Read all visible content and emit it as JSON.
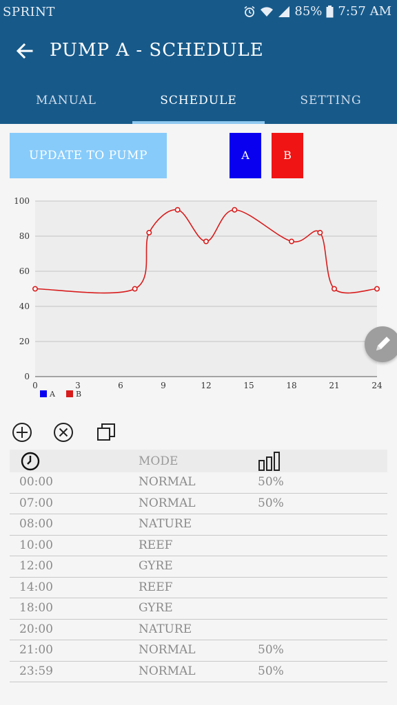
{
  "status_bar": {
    "carrier": "SPRINT",
    "battery": "85%",
    "time": "7:57 AM"
  },
  "app_bar": {
    "title": "PUMP A - SCHEDULE"
  },
  "tabs": [
    {
      "label": "MANUAL"
    },
    {
      "label": "SCHEDULE",
      "active": true
    },
    {
      "label": "SETTING"
    }
  ],
  "actions": {
    "update_label": "UPDATE TO PUMP",
    "pump_a_label": "A",
    "pump_b_label": "B"
  },
  "colors": {
    "header": "#175a8a",
    "update_button": "#87cbfa",
    "pump_a": "#0a00f0",
    "pump_b": "#f01414",
    "series_b": "#d81b1b"
  },
  "chart_data": {
    "type": "line",
    "x": [
      0,
      7,
      8,
      10,
      12,
      14,
      18,
      20,
      21,
      24
    ],
    "xticks": [
      0,
      3,
      6,
      9,
      12,
      15,
      18,
      21,
      24
    ],
    "yticks": [
      0,
      20,
      40,
      60,
      80,
      100
    ],
    "xlim": [
      0,
      24
    ],
    "ylim": [
      0,
      100
    ],
    "grid": true,
    "legend_position": "bottom-left",
    "series": [
      {
        "name": "A",
        "color": "#0a00f0",
        "values": []
      },
      {
        "name": "B",
        "color": "#d81b1b",
        "values": [
          50,
          50,
          82,
          95,
          77,
          95,
          77,
          82,
          50,
          50
        ]
      }
    ]
  },
  "table": {
    "header_mode": "MODE",
    "rows": [
      {
        "time": "00:00",
        "mode": "NORMAL",
        "level": "50%"
      },
      {
        "time": "07:00",
        "mode": "NORMAL",
        "level": "50%"
      },
      {
        "time": "08:00",
        "mode": "NATURE",
        "level": ""
      },
      {
        "time": "10:00",
        "mode": "REEF",
        "level": ""
      },
      {
        "time": "12:00",
        "mode": "GYRE",
        "level": ""
      },
      {
        "time": "14:00",
        "mode": "REEF",
        "level": ""
      },
      {
        "time": "18:00",
        "mode": "GYRE",
        "level": ""
      },
      {
        "time": "20:00",
        "mode": "NATURE",
        "level": ""
      },
      {
        "time": "21:00",
        "mode": "NORMAL",
        "level": "50%"
      },
      {
        "time": "23:59",
        "mode": "NORMAL",
        "level": "50%"
      }
    ]
  }
}
